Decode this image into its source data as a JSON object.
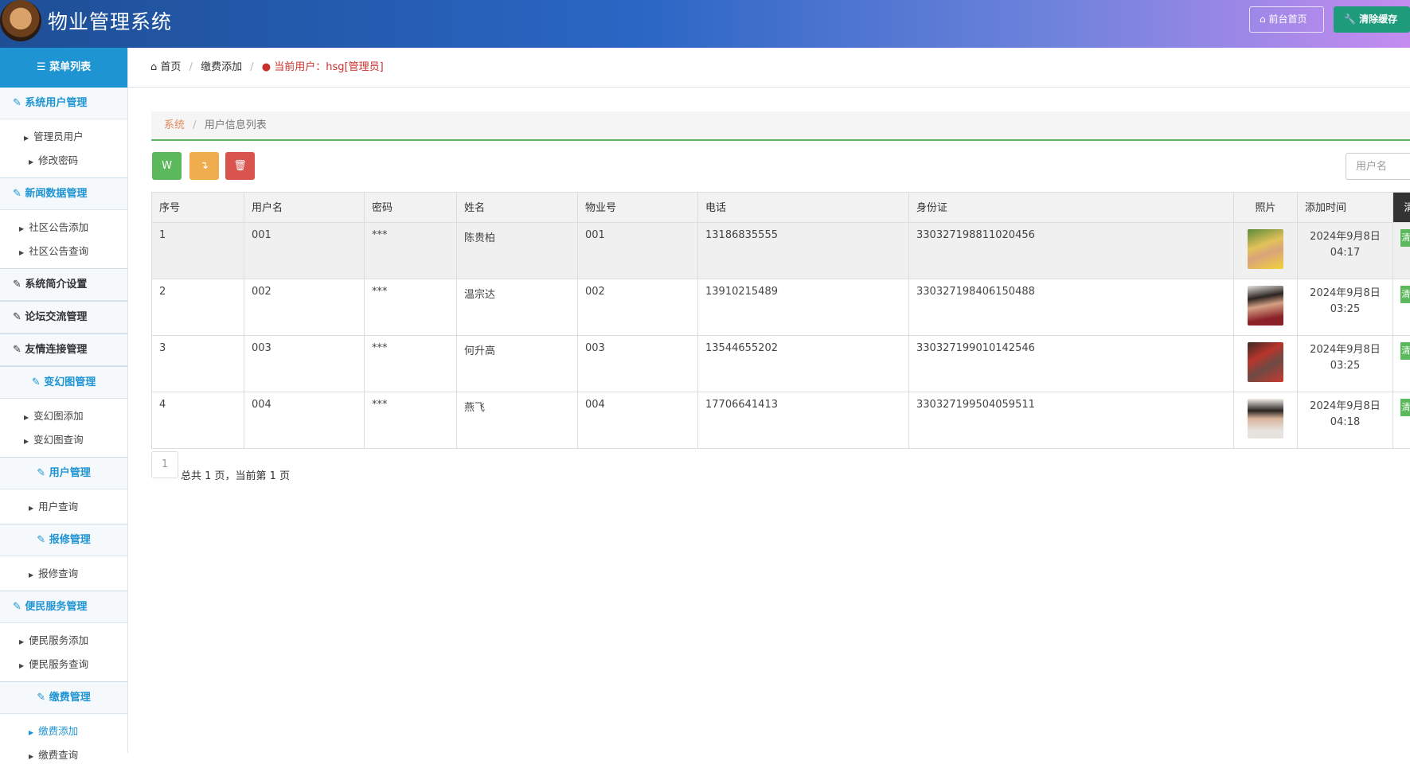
{
  "header": {
    "title": "物业管理系统",
    "front_btn": "前台首页",
    "clear_btn": "清除缓存"
  },
  "sidebar": {
    "head": "菜单列表",
    "groups": [
      {
        "title": "系统用户管理",
        "items": [
          "管理员用户",
          "修改密码"
        ]
      },
      {
        "title": "新闻数据管理",
        "items": [
          "社区公告添加",
          "社区公告查询"
        ]
      },
      {
        "title": "系统简介设置",
        "items": []
      },
      {
        "title": "论坛交流管理",
        "items": []
      },
      {
        "title": "友情连接管理",
        "items": []
      },
      {
        "title": "变幻图管理",
        "items": [
          "变幻图添加",
          "变幻图查询"
        ]
      },
      {
        "title": "用户管理",
        "items": [
          "用户查询"
        ]
      },
      {
        "title": "报修管理",
        "items": [
          "报修查询"
        ]
      },
      {
        "title": "便民服务管理",
        "items": [
          "便民服务添加",
          "便民服务查询"
        ]
      },
      {
        "title": "缴费管理",
        "items": [
          "缴费添加",
          "缴费查询"
        ]
      }
    ]
  },
  "breadcrumb": {
    "home": "首页",
    "page": "缴费添加",
    "user": "当前用户：hsg[管理员]"
  },
  "panel": {
    "crumb_sys": "系统",
    "crumb_page": "用户信息列表"
  },
  "search": {
    "placeholder": "用户名"
  },
  "table": {
    "headers": [
      "序号",
      "用户名",
      "密码",
      "姓名",
      "物业号",
      "电话",
      "身份证",
      "照片",
      "添加时间"
    ],
    "op_header": "清",
    "op_label": "清",
    "rows": [
      {
        "no": "1",
        "username": "001",
        "password": "***",
        "name": "陈贵柏",
        "property_no": "001",
        "phone": "13186835555",
        "id_card": "330327198811020456",
        "date": "2024年9月8日",
        "time": "04:17"
      },
      {
        "no": "2",
        "username": "002",
        "password": "***",
        "name": "温宗达",
        "property_no": "002",
        "phone": "13910215489",
        "id_card": "330327198406150488",
        "date": "2024年9月8日",
        "time": "03:25"
      },
      {
        "no": "3",
        "username": "003",
        "password": "***",
        "name": "何升高",
        "property_no": "003",
        "phone": "13544655202",
        "id_card": "330327199010142546",
        "date": "2024年9月8日",
        "time": "03:25"
      },
      {
        "no": "4",
        "username": "004",
        "password": "***",
        "name": "燕飞",
        "property_no": "004",
        "phone": "17706641413",
        "id_card": "330327199504059511",
        "date": "2024年9月8日",
        "time": "04:18"
      }
    ]
  },
  "pagination": {
    "current": "1",
    "info": "总共 1 页，当前第 1 页"
  },
  "colors": {
    "accent": "#1f94d2",
    "success": "#5cb85c",
    "warning": "#f0ad4e",
    "danger": "#d9534f",
    "user_red": "#c9302c"
  }
}
